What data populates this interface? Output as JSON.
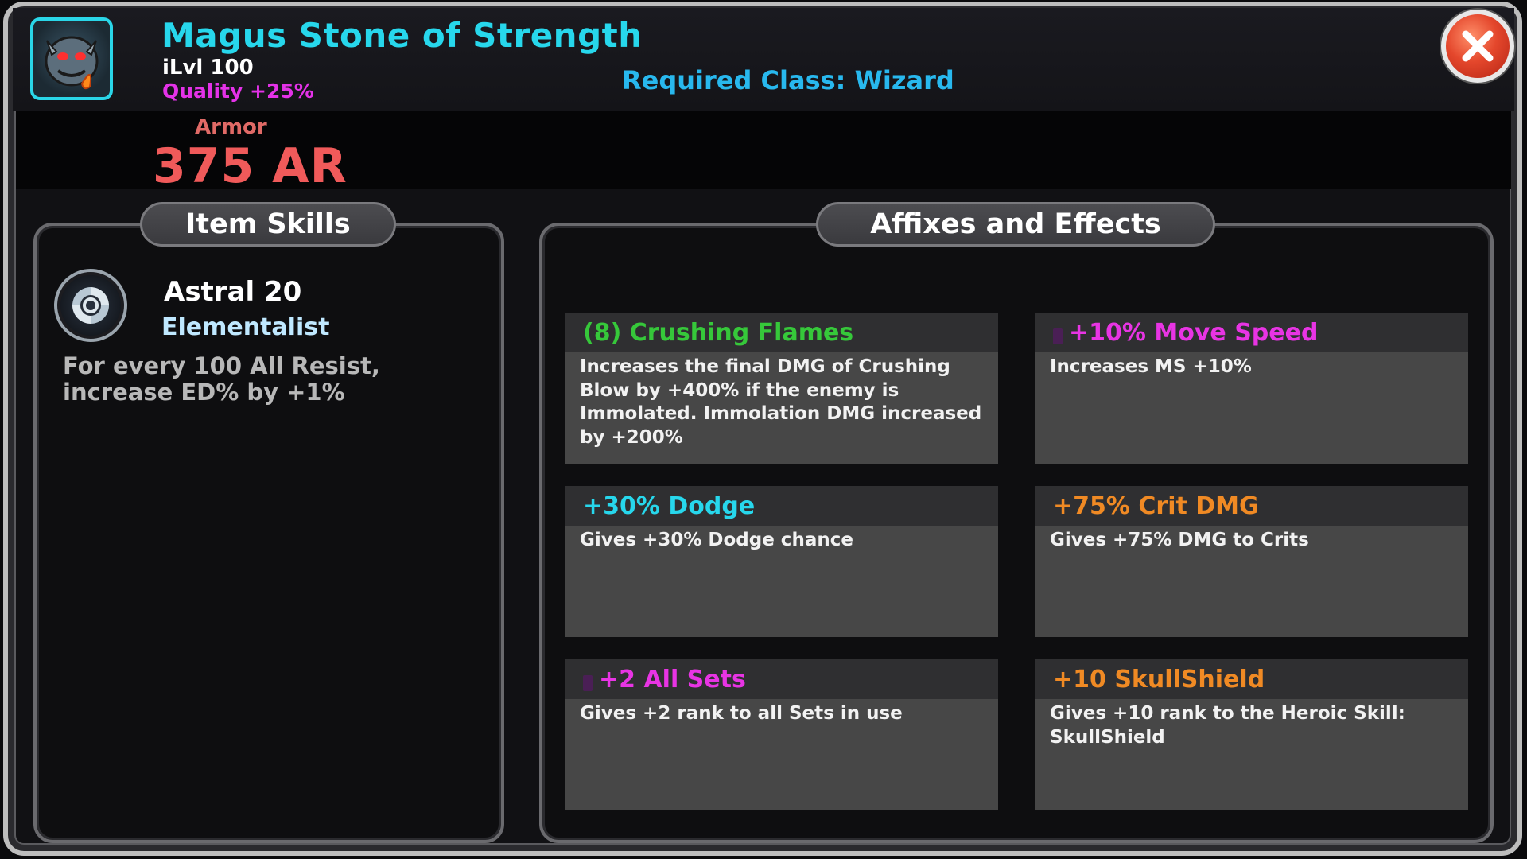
{
  "item": {
    "name": "Magus Stone of Strength",
    "ilvl": "iLvl 100",
    "quality": "Quality +25%",
    "required_class": "Required Class: Wizard",
    "icon": "demon-face-icon"
  },
  "armor": {
    "label": "Armor",
    "value": "375 AR"
  },
  "close": {
    "icon": "close-icon"
  },
  "item_skills": {
    "title": "Item Skills",
    "skill": {
      "icon": "swirl-icon",
      "name": "Astral 20",
      "class": "Elementalist",
      "description": "For every 100 All Resist, increase ED% by +1%"
    }
  },
  "affixes": {
    "title": "Affixes and Effects",
    "items": [
      {
        "name": "(8) Crushing Flames",
        "color": "#36c83a",
        "gem": false,
        "description": "Increases the final DMG of Crushing Blow by +400% if the enemy is Immolated. Immolation DMG increased by +200%"
      },
      {
        "name": "+10% Move Speed",
        "color": "#e834e4",
        "gem": true,
        "description": "Increases MS +10%"
      },
      {
        "name": "+30% Dodge",
        "color": "#27d7ec",
        "gem": false,
        "description": "Gives +30% Dodge chance"
      },
      {
        "name": "+75% Crit DMG",
        "color": "#f08a24",
        "gem": false,
        "description": "Gives +75% DMG to Crits"
      },
      {
        "name": "+2 All Sets",
        "color": "#e834e4",
        "gem": true,
        "description": "Gives +2 rank to all Sets in use"
      },
      {
        "name": "+10 SkullShield",
        "color": "#f08a24",
        "gem": false,
        "description": "Gives +10 rank to the Heroic Skill: SkullShield"
      }
    ]
  }
}
